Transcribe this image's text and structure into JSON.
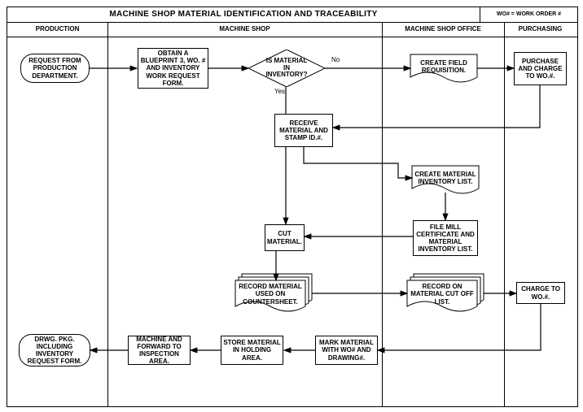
{
  "title": "MACHINE SHOP MATERIAL IDENTIFICATION AND TRACEABILITY",
  "title_note": "WO# = WORK ORDER #",
  "lanes": {
    "production": "PRODUCTION",
    "machineshop": "MACHINE SHOP",
    "office": "MACHINE SHOP OFFICE",
    "purchasing": "PURCHASING"
  },
  "nodes": {
    "request": "REQUEST FROM PRODUCTION DEPARTMENT.",
    "obtain": "OBTAIN A BLUEPRINT 3, WO. # AND INVENTORY WORK REQUEST FORM.",
    "decision": "IS MATERIAL IN INVENTORY?",
    "decision_no": "No",
    "decision_yes": "Yes",
    "create_req": "CREATE FIELD REQUISITION.",
    "purchase": "PURCHASE AND CHARGE TO WO.#.",
    "receive": "RECEIVE MATERIAL AND STAMP ID.#.",
    "inv_list": "CREATE MATERIAL INVENTORY LIST.",
    "file_mill": "FILE MILL CERTIFICATE AND MATERIAL INVENTORY LIST.",
    "cut": "CUT MATERIAL.",
    "counter": "RECORD MATERIAL USED ON COUNTERSHEET.",
    "cutoff": "RECORD ON MATERIAL CUT OFF LIST.",
    "charge": "CHARGE TO WO.#.",
    "mark": "MARK MATERIAL WITH WO# AND DRAWING#.",
    "store": "STORE MATERIAL IN HOLDING AREA.",
    "machine": "MACHINE AND FORWARD TO INSPECTION AREA.",
    "drwg": "DRWG. PKG. INCLUDING INVENTORY REQUEST FORM."
  }
}
